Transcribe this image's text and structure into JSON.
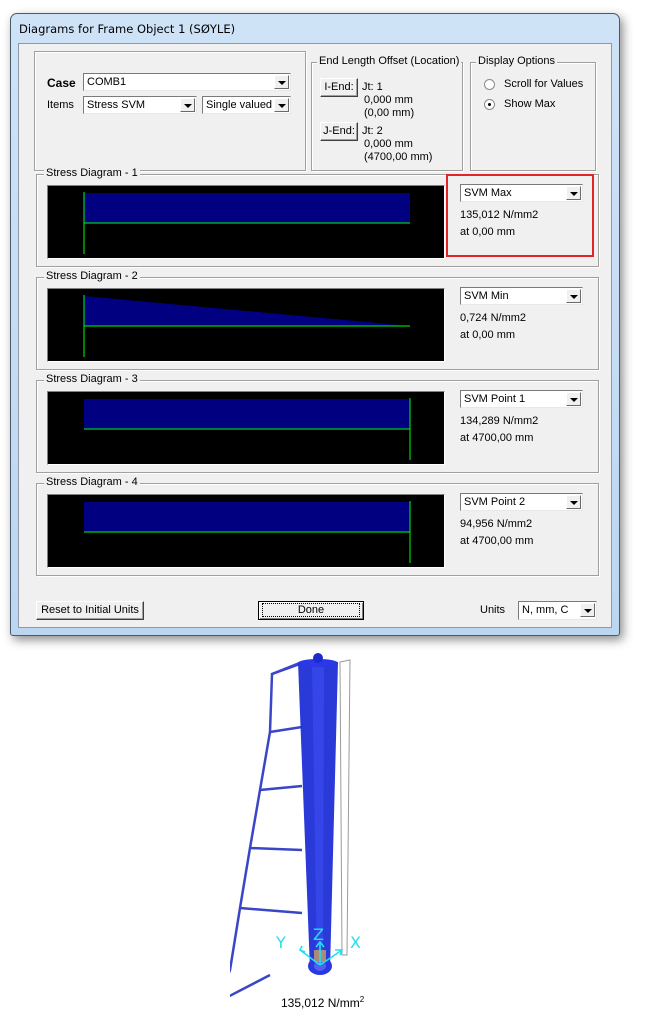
{
  "window": {
    "title": "Diagrams for Frame Object 1  (SØYLE)"
  },
  "case_group": {
    "case_label": "Case",
    "case_value": "COMB1",
    "items_label": "Items",
    "items_value": "Stress SVM",
    "items_mode": "Single valued"
  },
  "end_offset": {
    "title": "End Length Offset (Location)",
    "i_end": {
      "button": "I-End:",
      "joint": "Jt:  1",
      "offset": "0,000 mm",
      "location": "(0,00 mm)"
    },
    "j_end": {
      "button": "J-End:",
      "joint": "Jt:  2",
      "offset": "0,000 mm",
      "location": "(4700,00 mm)"
    }
  },
  "display_options": {
    "title": "Display Options",
    "options": [
      {
        "label": "Scroll for Values",
        "selected": false
      },
      {
        "label": "Show Max",
        "selected": true
      }
    ]
  },
  "diagrams": [
    {
      "title": "Stress Diagram - 1",
      "selector": "SVM Max",
      "value": "135,012 N/mm2",
      "location": "at 0,00 mm",
      "highlighted": true,
      "shape": "rect",
      "marker_at": "start",
      "start_frac": 1.0,
      "end_frac": 1.0
    },
    {
      "title": "Stress Diagram - 2",
      "selector": "SVM Min",
      "value": "0,724 N/mm2",
      "location": "at 0,00 mm",
      "highlighted": false,
      "shape": "taper",
      "marker_at": "start",
      "start_frac": 1.0,
      "end_frac": 0.0
    },
    {
      "title": "Stress Diagram - 3",
      "selector": "SVM Point 1",
      "value": "134,289 N/mm2",
      "location": "at 4700,00 mm",
      "highlighted": false,
      "shape": "rect",
      "marker_at": "end",
      "start_frac": 1.0,
      "end_frac": 1.0
    },
    {
      "title": "Stress Diagram - 4",
      "selector": "SVM Point 2",
      "value": "94,956 N/mm2",
      "location": "at 4700,00 mm",
      "highlighted": false,
      "shape": "rect",
      "marker_at": "end",
      "start_frac": 1.0,
      "end_frac": 1.0
    }
  ],
  "footer": {
    "reset_button": "Reset to Initial Units",
    "done_button": "Done",
    "units_label": "Units",
    "units_value": "N, mm, C"
  },
  "model_view": {
    "axes": [
      "X",
      "Y",
      "Z"
    ],
    "stress_value": "135,012 N/mm",
    "stress_exponent": "2",
    "colors": {
      "member": "#1f2fd6",
      "diagram_outline": "#3a46c8",
      "axes": "#22e0f0"
    }
  },
  "colors": {
    "diagram_bg": "#000000",
    "diagram_fill": "#000080",
    "diagram_axis": "#00ff00",
    "highlight": "#e2232a"
  }
}
